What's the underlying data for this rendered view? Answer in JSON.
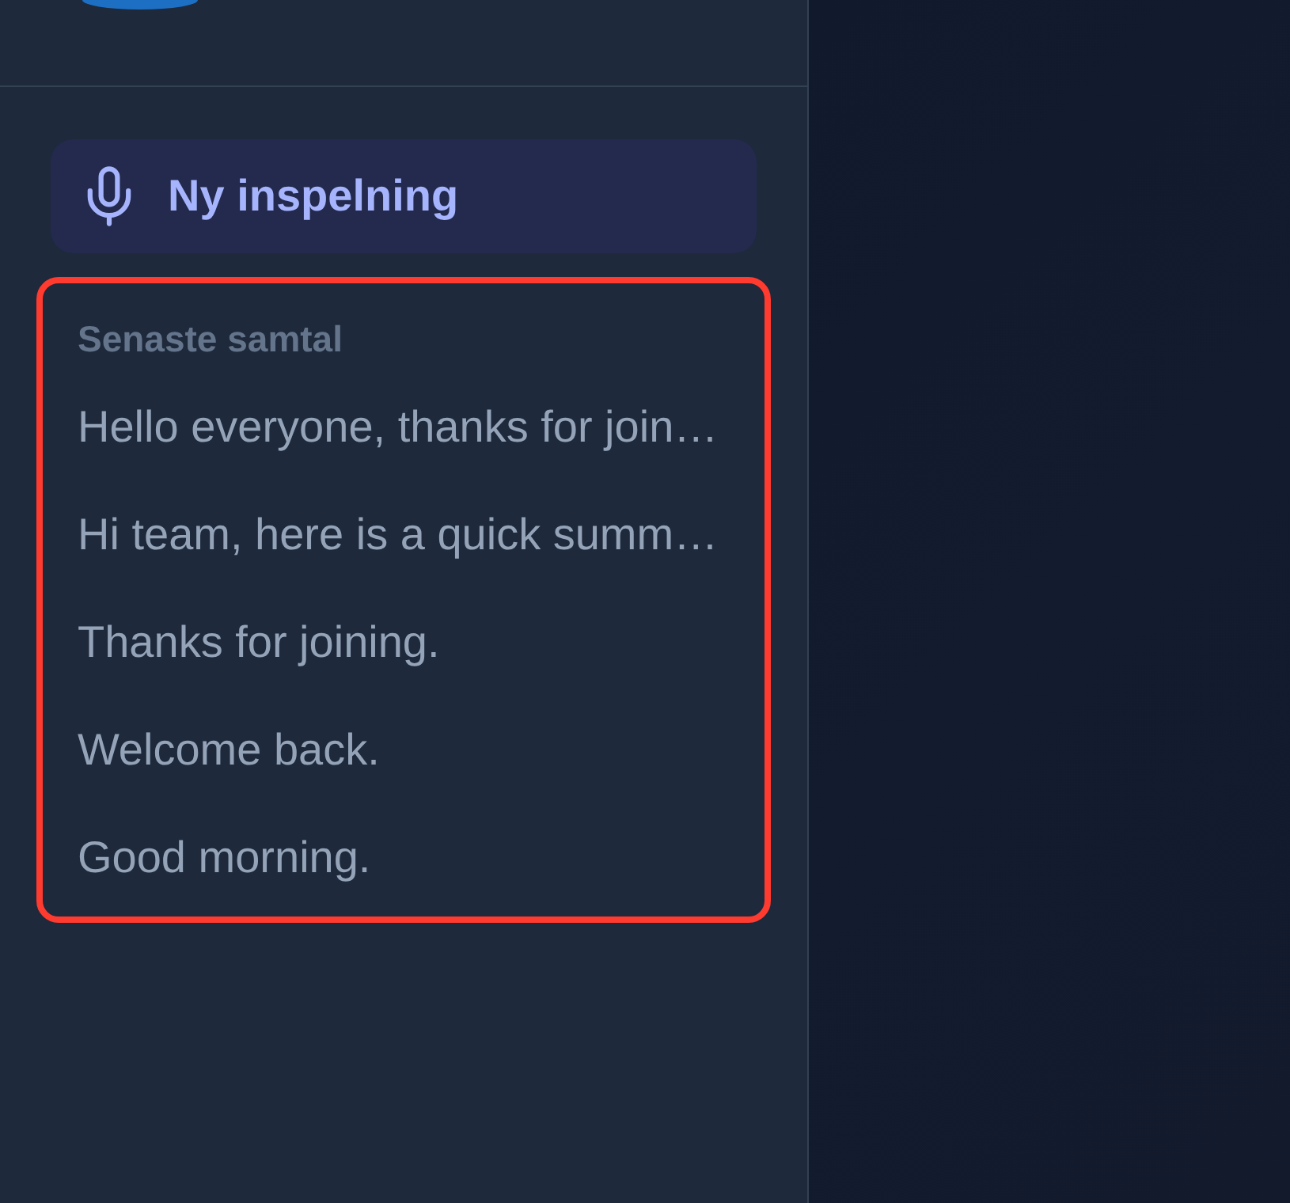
{
  "sidebar": {
    "new_recording": {
      "label": "Ny inspelning"
    },
    "recent": {
      "highlighted": true,
      "heading": "Senaste samtal",
      "items": [
        {
          "title": "Hello everyone, thanks for join…"
        },
        {
          "title": "Hi team, here is a quick summ…"
        },
        {
          "title": "Thanks for joining."
        },
        {
          "title": "Welcome back."
        },
        {
          "title": "Good morning."
        }
      ]
    }
  }
}
